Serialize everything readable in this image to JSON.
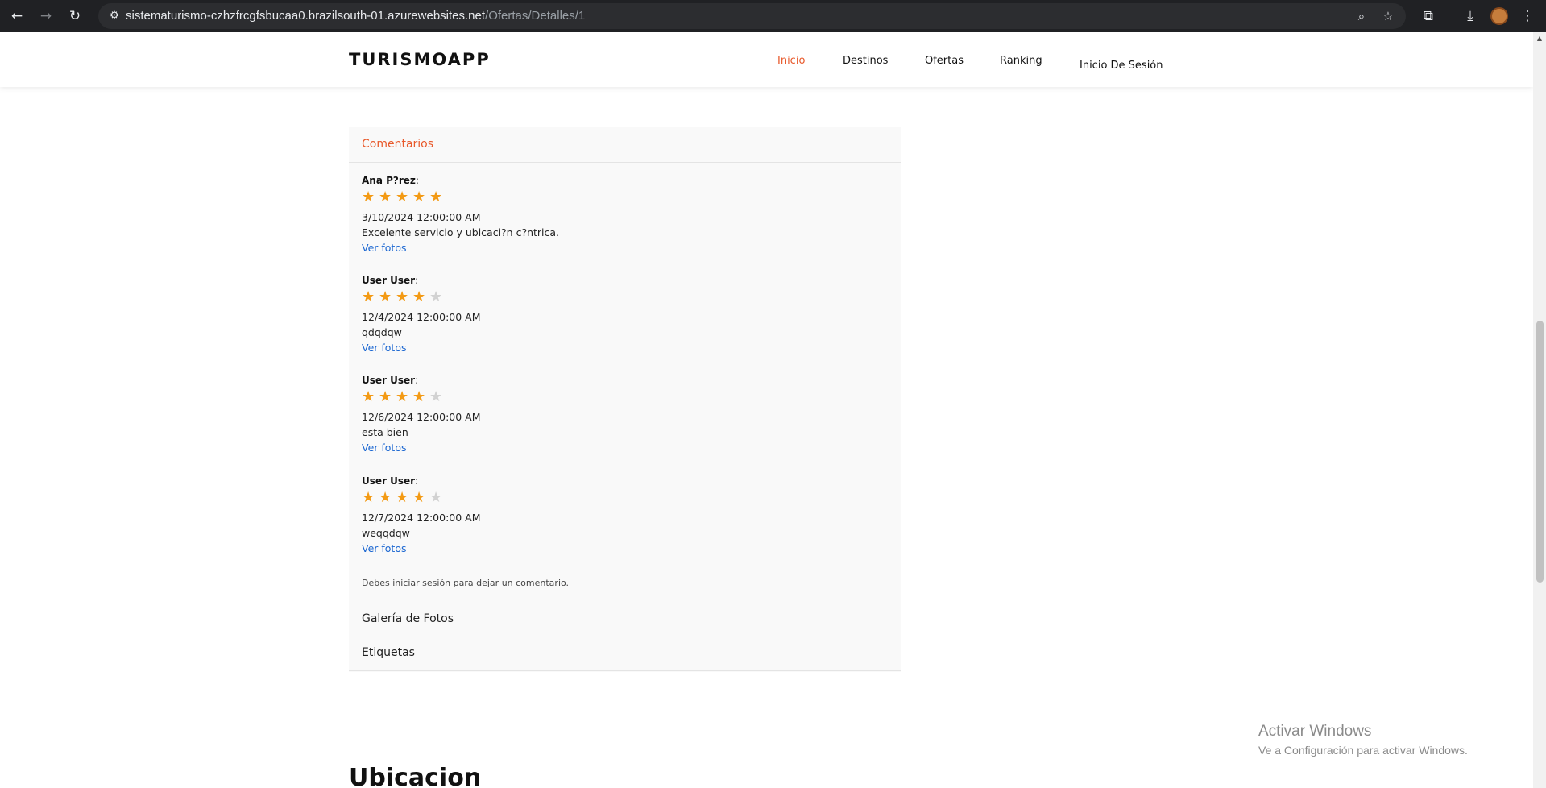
{
  "browser": {
    "back_icon": "←",
    "forward_icon": "→",
    "reload_icon": "↻",
    "site_info_icon": "⚙",
    "url_host": "sistematurismo-czhzfrcgfsbucaa0.brazilsouth-01.azurewebsites.net",
    "url_path": "/Ofertas/Detalles/1",
    "zoom_icon": "⌕",
    "bookmark_icon": "☆",
    "extensions_icon": "⧉",
    "download_icon": "⤓",
    "menu_icon": "⋮"
  },
  "navbar": {
    "brand": "TURISMOAPP",
    "links": [
      {
        "label": "Inicio",
        "active": true
      },
      {
        "label": "Destinos",
        "active": false
      },
      {
        "label": "Ofertas",
        "active": false
      },
      {
        "label": "Ranking",
        "active": false
      },
      {
        "label": "Inicio De Sesión",
        "active": false
      }
    ]
  },
  "comments_panel": {
    "title": "Comentarios",
    "comments": [
      {
        "author": "Ana P?rez",
        "colon": ":",
        "rating": 5,
        "max_rating": 5,
        "date": "3/10/2024 12:00:00 AM",
        "text": "Excelente servicio y ubicaci?n c?ntrica.",
        "photos_link": "Ver fotos"
      },
      {
        "author": "User User",
        "colon": ":",
        "rating": 4,
        "max_rating": 5,
        "date": "12/4/2024 12:00:00 AM",
        "text": "qdqdqw",
        "photos_link": "Ver fotos"
      },
      {
        "author": "User User",
        "colon": ":",
        "rating": 4,
        "max_rating": 5,
        "date": "12/6/2024 12:00:00 AM",
        "text": "esta bien",
        "photos_link": "Ver fotos"
      },
      {
        "author": "User User",
        "colon": ":",
        "rating": 4,
        "max_rating": 5,
        "date": "12/7/2024 12:00:00 AM",
        "text": "weqqdqw",
        "photos_link": "Ver fotos"
      }
    ],
    "login_note": "Debes iniciar sesión para dejar un comentario.",
    "gallery_label": "Galería de Fotos",
    "tags_label": "Etiquetas"
  },
  "location_title": "Ubicacion",
  "watermark": {
    "title": "Activar Windows",
    "subtitle": "Ve a Configuración para activar Windows."
  },
  "colors": {
    "accent": "#e8592b",
    "star_on": "#f39a14",
    "star_off": "#d2d2d2",
    "link": "#1a66d1"
  }
}
